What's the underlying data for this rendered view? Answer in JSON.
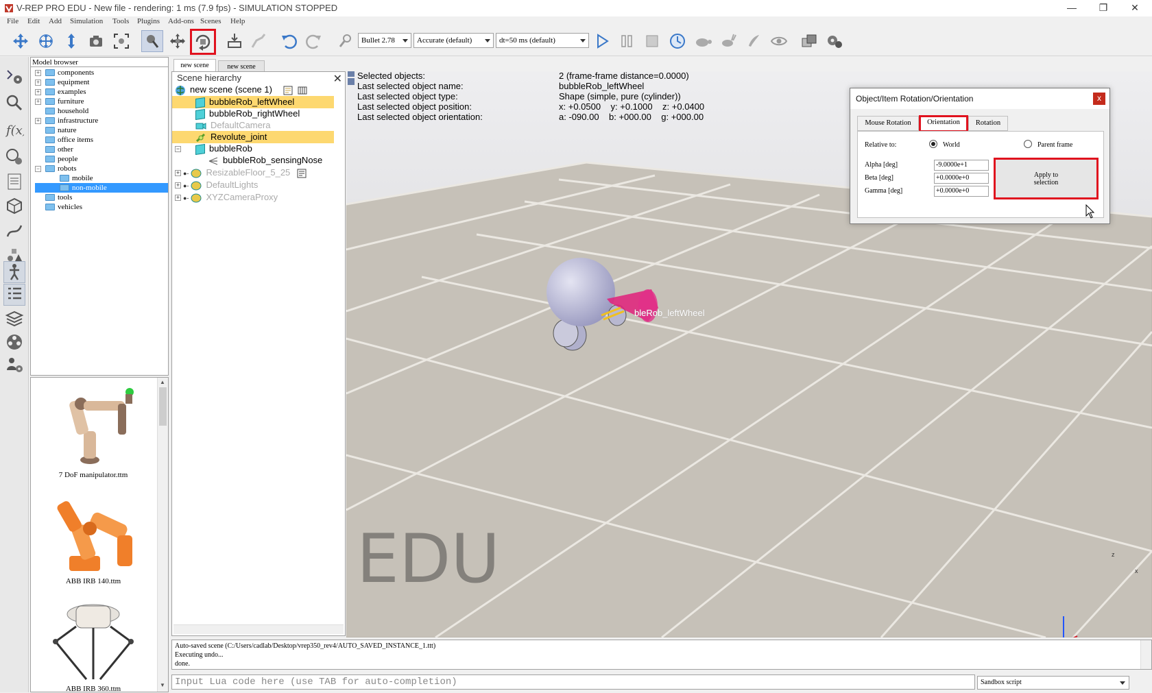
{
  "window": {
    "title": "V-REP PRO EDU - New file - rendering: 1 ms (7.9 fps) - SIMULATION STOPPED",
    "minimize": "—",
    "maximize": "❐",
    "close": "✕"
  },
  "menu": [
    "File",
    "Edit",
    "Add",
    "Simulation",
    "Tools",
    "Plugins",
    "Add-ons",
    "Scenes",
    "Help"
  ],
  "toolbar": {
    "engine": "Bullet 2.78",
    "accuracy": "Accurate (default)",
    "timestep": "dt=50 ms (default)"
  },
  "model_browser": {
    "header": "Model browser",
    "items": [
      {
        "label": "components",
        "expandable": true
      },
      {
        "label": "equipment",
        "expandable": true
      },
      {
        "label": "examples",
        "expandable": true
      },
      {
        "label": "furniture",
        "expandable": true
      },
      {
        "label": "household",
        "expandable": false
      },
      {
        "label": "infrastructure",
        "expandable": true
      },
      {
        "label": "nature",
        "expandable": false
      },
      {
        "label": "office items",
        "expandable": false
      },
      {
        "label": "other",
        "expandable": false
      },
      {
        "label": "people",
        "expandable": false
      },
      {
        "label": "robots",
        "expandable": true
      },
      {
        "label": "mobile",
        "expandable": false
      },
      {
        "label": "non-mobile",
        "expandable": false,
        "selected": true
      },
      {
        "label": "tools",
        "expandable": false
      },
      {
        "label": "vehicles",
        "expandable": false
      }
    ]
  },
  "thumbnails": [
    {
      "caption": "7 DoF manipulator.ttm"
    },
    {
      "caption": "ABB IRB 140.ttm"
    },
    {
      "caption": "ABB IRB 360.ttm"
    }
  ],
  "scene_tabs": [
    "new scene",
    "new scene"
  ],
  "hierarchy": {
    "header": "Scene hierarchy",
    "root": "new scene (scene 1)",
    "items": [
      {
        "label": "bubbleRob_leftWheel",
        "selected": true
      },
      {
        "label": "bubbleRob_rightWheel",
        "selected": false
      },
      {
        "label": "DefaultCamera",
        "selected": false
      },
      {
        "label": "Revolute_joint",
        "selected": true
      },
      {
        "label": "bubbleRob",
        "selected": false
      },
      {
        "label": "bubbleRob_sensingNose",
        "selected": false
      },
      {
        "label": "ResizableFloor_5_25",
        "selected": false
      },
      {
        "label": "DefaultLights",
        "selected": false
      },
      {
        "label": "XYZCameraProxy",
        "selected": false
      }
    ]
  },
  "viewport": {
    "info_labels": [
      "Selected objects:",
      "Last selected object name:",
      "Last selected object type:",
      "Last selected object position:",
      "Last selected object orientation:"
    ],
    "info_values": [
      "2 (frame-frame distance=0.0000)",
      "bubbleRob_leftWheel",
      "Shape (simple, pure (cylinder))",
      "x: +0.0500    y: +0.1000    z: +0.0400",
      "a: -090.00    b: +000.00    g: +000.00"
    ],
    "object_label": "bleRob_leftWheel",
    "watermark": "EDU",
    "axis_z": "z",
    "axis_x": "x"
  },
  "dialog": {
    "title": "Object/Item Rotation/Orientation",
    "close": "x",
    "tabs": [
      "Mouse Rotation",
      "Orientation",
      "Rotation"
    ],
    "relative_to_label": "Relative to:",
    "option_world": "World",
    "option_parent": "Parent frame",
    "alpha_label": "Alpha [deg]",
    "beta_label": "Beta [deg]",
    "gamma_label": "Gamma [deg]",
    "alpha_value": "-9.0000e+1",
    "beta_value": "+0.0000e+0",
    "gamma_value": "+0.0000e+0",
    "apply_line1": "Apply to",
    "apply_line2": "selection"
  },
  "console": {
    "lines": [
      "Auto-saved scene (C:/Users/cadlab/Desktop/vrep350_rev4/AUTO_SAVED_INSTANCE_1.ttt)",
      "Executing undo...",
      "done."
    ],
    "input_placeholder": "Input Lua code here (use TAB for auto-completion)",
    "script_selector": "Sandbox script"
  },
  "colors": {
    "selection": "#fdd870",
    "highlight": "#e0121e",
    "tree_selection": "#3399ff"
  }
}
